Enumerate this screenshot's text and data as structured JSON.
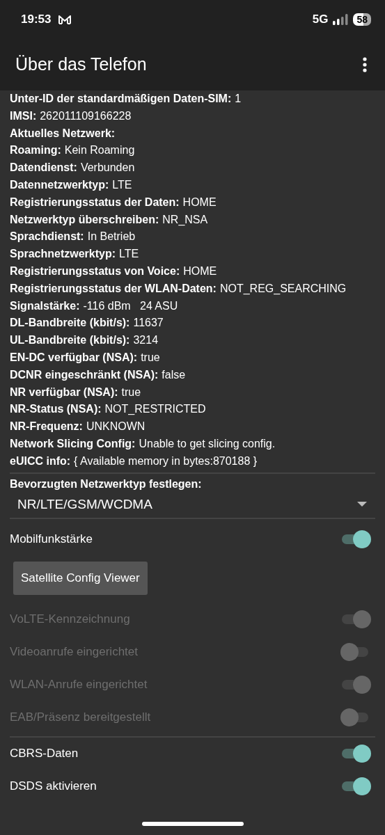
{
  "status_bar": {
    "time": "19:53",
    "network": "5G",
    "battery": "58"
  },
  "app_bar": {
    "title": "Über das Telefon"
  },
  "info": [
    {
      "label": "Unter-ID der standardmäßigen Daten-SIM:",
      "value": "1"
    },
    {
      "label": "IMSI:",
      "value": "262011109166228"
    },
    {
      "label": "Aktuelles Netzwerk:"
    },
    {
      "label": "Roaming:",
      "value": "Kein Roaming"
    },
    {
      "label": "Datendienst:",
      "value": "Verbunden"
    },
    {
      "label": "Datennetzwerktyp:",
      "value": "LTE"
    },
    {
      "label": "Registrierungsstatus der Daten:",
      "value": "HOME"
    },
    {
      "label": "Netzwerktyp überschreiben:",
      "value": "NR_NSA"
    },
    {
      "label": "Sprachdienst:",
      "value": "In Betrieb"
    },
    {
      "label": "Sprachnetzwerktyp:",
      "value": "LTE"
    },
    {
      "label": "Registrierungsstatus von Voice:",
      "value": "HOME"
    },
    {
      "label": "Registrierungsstatus der WLAN-Daten:",
      "value": "NOT_REG_SEARCHING"
    },
    {
      "label": "Signalstärke:",
      "value": "-116 dBm   24 ASU"
    },
    {
      "label": "DL-Bandbreite (kbit/s):",
      "value": "11637"
    },
    {
      "label": "UL-Bandbreite (kbit/s):",
      "value": "3214"
    },
    {
      "label": "EN-DC verfügbar (NSA):",
      "value": "true"
    },
    {
      "label": "DCNR eingeschränkt (NSA):",
      "value": "false"
    },
    {
      "label": "NR verfügbar (NSA):",
      "value": "true"
    },
    {
      "label": "NR-Status (NSA):",
      "value": "NOT_RESTRICTED"
    },
    {
      "label": "NR-Frequenz:",
      "value": "UNKNOWN"
    },
    {
      "label": "Network Slicing Config:",
      "value": "Unable to get slicing config."
    },
    {
      "label": "eUICC info:",
      "value": "{ Available memory in bytes:870188 }"
    }
  ],
  "network_type": {
    "label": "Bevorzugten Netzwerktyp festlegen:",
    "value": "NR/LTE/GSM/WCDMA"
  },
  "settings": [
    {
      "kind": "toggle",
      "label": "Mobilfunkstärke",
      "on": true,
      "disabled": false
    },
    {
      "kind": "button",
      "label": "Satellite Config Viewer"
    },
    {
      "kind": "toggle",
      "label": "VoLTE-Kennzeichnung",
      "on": true,
      "disabled": true
    },
    {
      "kind": "toggle",
      "label": "Videoanrufe eingerichtet",
      "on": false,
      "disabled": true
    },
    {
      "kind": "toggle",
      "label": "WLAN-Anrufe eingerichtet",
      "on": true,
      "disabled": true
    },
    {
      "kind": "toggle",
      "label": "EAB/Präsenz bereitgestellt",
      "on": false,
      "disabled": true
    },
    {
      "kind": "divider"
    },
    {
      "kind": "toggle",
      "label": "CBRS-Daten",
      "on": true,
      "disabled": false
    },
    {
      "kind": "toggle",
      "label": "DSDS aktivieren",
      "on": true,
      "disabled": false
    }
  ]
}
